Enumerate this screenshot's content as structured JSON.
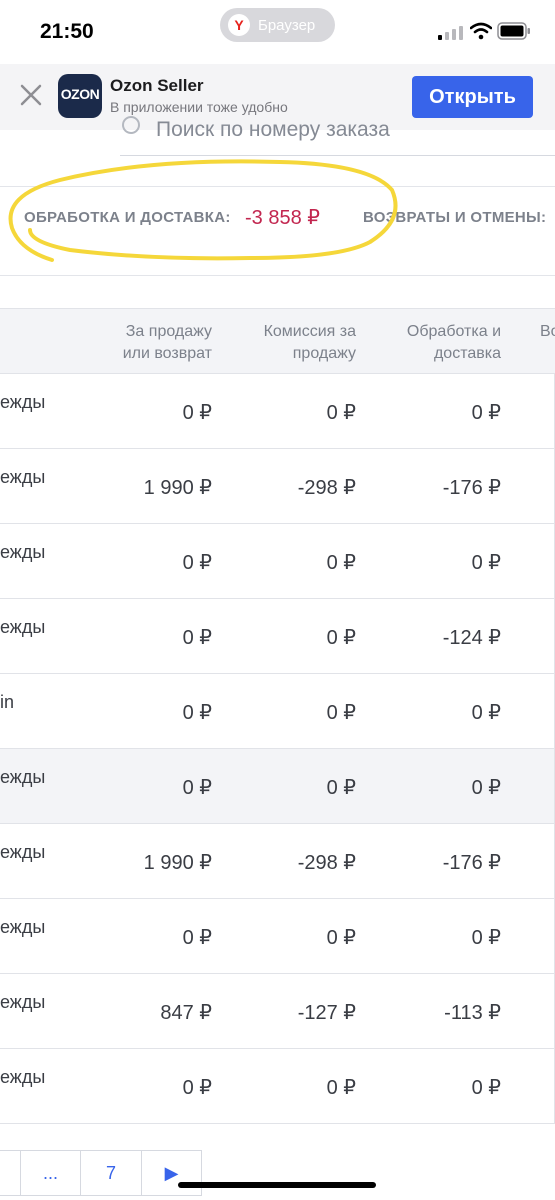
{
  "status_bar": {
    "time": "21:50",
    "browser_label": "Браузер",
    "browser_logo": "Y"
  },
  "app_banner": {
    "logo_text": "OZON",
    "title": "Ozon Seller",
    "subtitle": "В приложении тоже удобно",
    "open_label": "Открыть"
  },
  "search": {
    "placeholder": "Поиск по номеру заказа"
  },
  "summary": {
    "processing_label": "ОБРАБОТКА И ДОСТАВКА:",
    "processing_value": "-3 858 ₽",
    "returns_label": "ВОЗВРАТЫ И ОТМЕНЫ:"
  },
  "table": {
    "headers": {
      "sale": "За продажу или возврат",
      "commission": "Комиссия за продажу",
      "processing": "Обработка и доставка",
      "next": "Во"
    },
    "rows": [
      {
        "name": "ежды",
        "sale": "0 ₽",
        "commission": "0 ₽",
        "processing": "0 ₽"
      },
      {
        "name": "ежды",
        "sale": "1 990 ₽",
        "commission": "-298 ₽",
        "processing": "-176 ₽"
      },
      {
        "name": "ежды",
        "sale": "0 ₽",
        "commission": "0 ₽",
        "processing": "0 ₽"
      },
      {
        "name": "ежды",
        "sale": "0 ₽",
        "commission": "0 ₽",
        "processing": "-124 ₽"
      },
      {
        "name": "in",
        "sale": "0 ₽",
        "commission": "0 ₽",
        "processing": "0 ₽"
      },
      {
        "name": "ежды",
        "sale": "0 ₽",
        "commission": "0 ₽",
        "processing": "0 ₽"
      },
      {
        "name": "ежды",
        "sale": "1 990 ₽",
        "commission": "-298 ₽",
        "processing": "-176 ₽"
      },
      {
        "name": "ежды",
        "sale": "0 ₽",
        "commission": "0 ₽",
        "processing": "0 ₽"
      },
      {
        "name": "ежды",
        "sale": "847 ₽",
        "commission": "-127 ₽",
        "processing": "-113 ₽"
      },
      {
        "name": "ежды",
        "sale": "0 ₽",
        "commission": "0 ₽",
        "processing": "0 ₽"
      }
    ]
  },
  "pagination": {
    "ellipsis": "...",
    "page": "7",
    "next_glyph": "▶"
  },
  "colors": {
    "accent": "#3864ea",
    "negative": "#c2264f",
    "highlight": "#f5d73a"
  }
}
